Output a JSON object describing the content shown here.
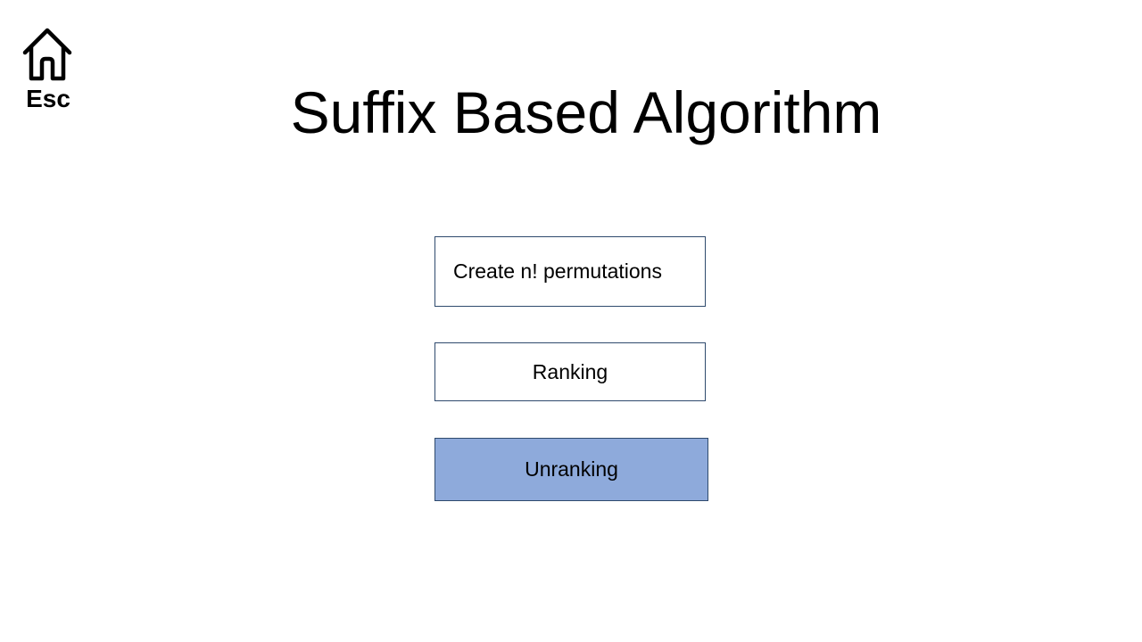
{
  "home": {
    "icon": "home-icon",
    "label": "Esc"
  },
  "title": "Suffix Based Algorithm",
  "menu": {
    "create_label": "Create n! permutations",
    "ranking_label": "Ranking",
    "unranking_label": "Unranking"
  },
  "colors": {
    "button_border": "#2f4a6d",
    "button_bg": "#ffffff",
    "selected_bg": "#8eaadb",
    "text": "#000000"
  },
  "selected": "unranking"
}
